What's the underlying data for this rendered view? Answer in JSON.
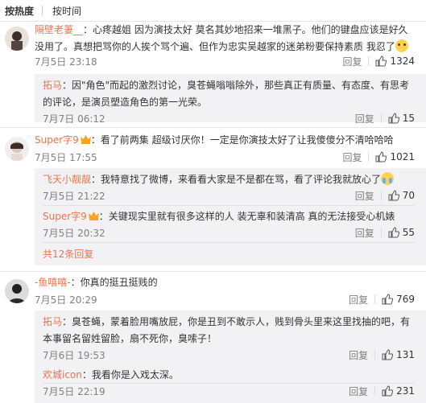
{
  "sort": {
    "hot": "按热度",
    "time": "按时间"
  },
  "actions": {
    "reply": "回复"
  },
  "comments": [
    {
      "user": "隔壁老萋__",
      "text": "：心疼越姐 因为演技太好 莫名其妙地招来一堆黑子。他们的键盘应该是好久没用了。真想把骂你的人挨个骂个遍、但作为忠实吴越家的迷弟粉要保持素质 我忍了",
      "time": "7月5日 23:18",
      "likes": "1324",
      "replies": [
        {
          "user": "拓马",
          "text": "：因\"角色\"而起的激烈讨论，臭苍蝇嗡嗡除外，那些真正有质量、有态度、有思考的评论，是演员塑造角色的第一光荣。",
          "time": "7月7日 06:12",
          "likes": "15"
        }
      ]
    },
    {
      "user": "Super字9",
      "text": "：看了前两集 超级讨厌你！一定是你演技太好了让我傻傻分不清哈哈哈",
      "time": "7月5日 17:55",
      "likes": "1021",
      "replies": [
        {
          "user": "飞天小靓靓",
          "text": "：我特意找了微博，来看看大家是不是都在骂，看了评论我就放心了",
          "time": "7月5日 21:22",
          "likes": "70"
        },
        {
          "user": "Super字9",
          "text": "：关键现实里就有很多这样的人 装无辜和装清高 真的无法接受心机婊",
          "time": "7月5日 20:32",
          "likes": "55"
        }
      ],
      "more": "共12条回复"
    },
    {
      "user": "-鱼嘻嘻-",
      "text": "：你真的挺丑挺贱的",
      "time": "7月5日 20:29",
      "likes": "769",
      "replies": [
        {
          "user": "拓马",
          "text": "：臭苍蝇，蒙着脸用嘴放屁，你是丑到不敢示人，贱到骨头里来这里找抽的吧，有本事留名留姓留脸，扇不死你，臭嗦子！",
          "time": "7月6日 19:53",
          "likes": "131"
        },
        {
          "user": "欢城icon",
          "text": "：我看你是入戏太深。",
          "time": "7月5日 22:19",
          "likes": "231"
        }
      ]
    }
  ]
}
